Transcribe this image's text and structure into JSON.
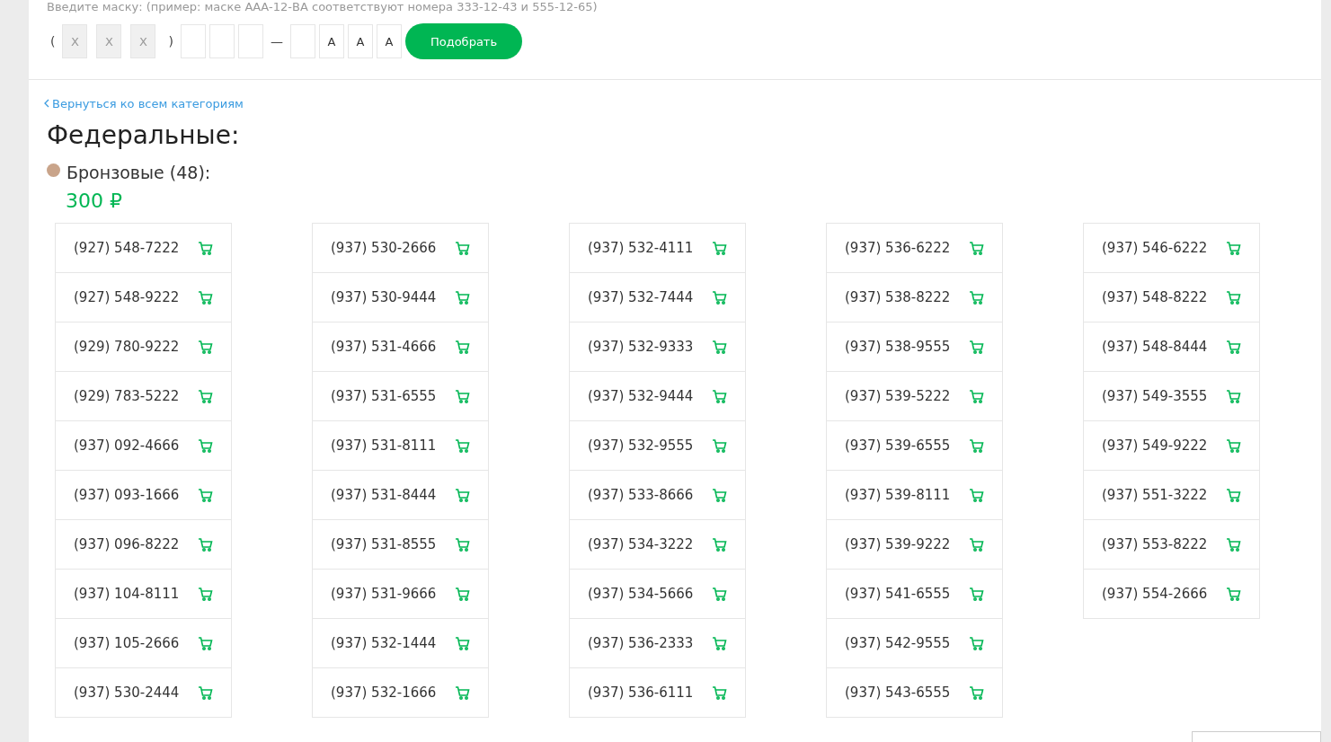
{
  "mask": {
    "hint": "Введите маску: (пример: маске ААА-12-ВА соответствуют номера 333-12-43 и 555-12-65)",
    "parts": [
      {
        "kind": "sep",
        "text": "("
      },
      {
        "kind": "field",
        "value": "X",
        "disabled": true
      },
      {
        "kind": "field",
        "value": "X",
        "disabled": true
      },
      {
        "kind": "field",
        "value": "X",
        "disabled": true
      },
      {
        "kind": "sep",
        "text": ")"
      },
      {
        "kind": "field",
        "disabled": false
      },
      {
        "kind": "field",
        "disabled": false
      },
      {
        "kind": "field",
        "disabled": false
      },
      {
        "kind": "sep",
        "text": "—"
      },
      {
        "kind": "field",
        "disabled": false
      },
      {
        "kind": "field",
        "value": "A",
        "disabled": false
      },
      {
        "kind": "field",
        "value": "A",
        "disabled": false
      },
      {
        "kind": "field",
        "value": "A",
        "disabled": false
      }
    ],
    "button": "Подобрать"
  },
  "back_link": "Вернуться ко всем категориям",
  "title": "Федеральные:",
  "category": {
    "name": "Бронзовые (48):",
    "color": "#c9a48a",
    "price": "300 ₽"
  },
  "columns": [
    [
      "(927) 548-7222",
      "(927) 548-9222",
      "(929) 780-9222",
      "(929) 783-5222",
      "(937) 092-4666",
      "(937) 093-1666",
      "(937) 096-8222",
      "(937) 104-8111",
      "(937) 105-2666",
      "(937) 530-2444"
    ],
    [
      "(937) 530-2666",
      "(937) 530-9444",
      "(937) 531-4666",
      "(937) 531-6555",
      "(937) 531-8111",
      "(937) 531-8444",
      "(937) 531-8555",
      "(937) 531-9666",
      "(937) 532-1444",
      "(937) 532-1666"
    ],
    [
      "(937) 532-4111",
      "(937) 532-7444",
      "(937) 532-9333",
      "(937) 532-9444",
      "(937) 532-9555",
      "(937) 533-8666",
      "(937) 534-3222",
      "(937) 534-5666",
      "(937) 536-2333",
      "(937) 536-6111"
    ],
    [
      "(937) 536-6222",
      "(937) 538-8222",
      "(937) 538-9555",
      "(937) 539-5222",
      "(937) 539-6555",
      "(937) 539-8111",
      "(937) 539-9222",
      "(937) 541-6555",
      "(937) 542-9555",
      "(937) 543-6555"
    ],
    [
      "(937) 546-6222",
      "(937) 548-8222",
      "(937) 548-8444",
      "(937) 549-3555",
      "(937) 549-9222",
      "(937) 551-3222",
      "(937) 553-8222",
      "(937) 554-2666"
    ]
  ]
}
